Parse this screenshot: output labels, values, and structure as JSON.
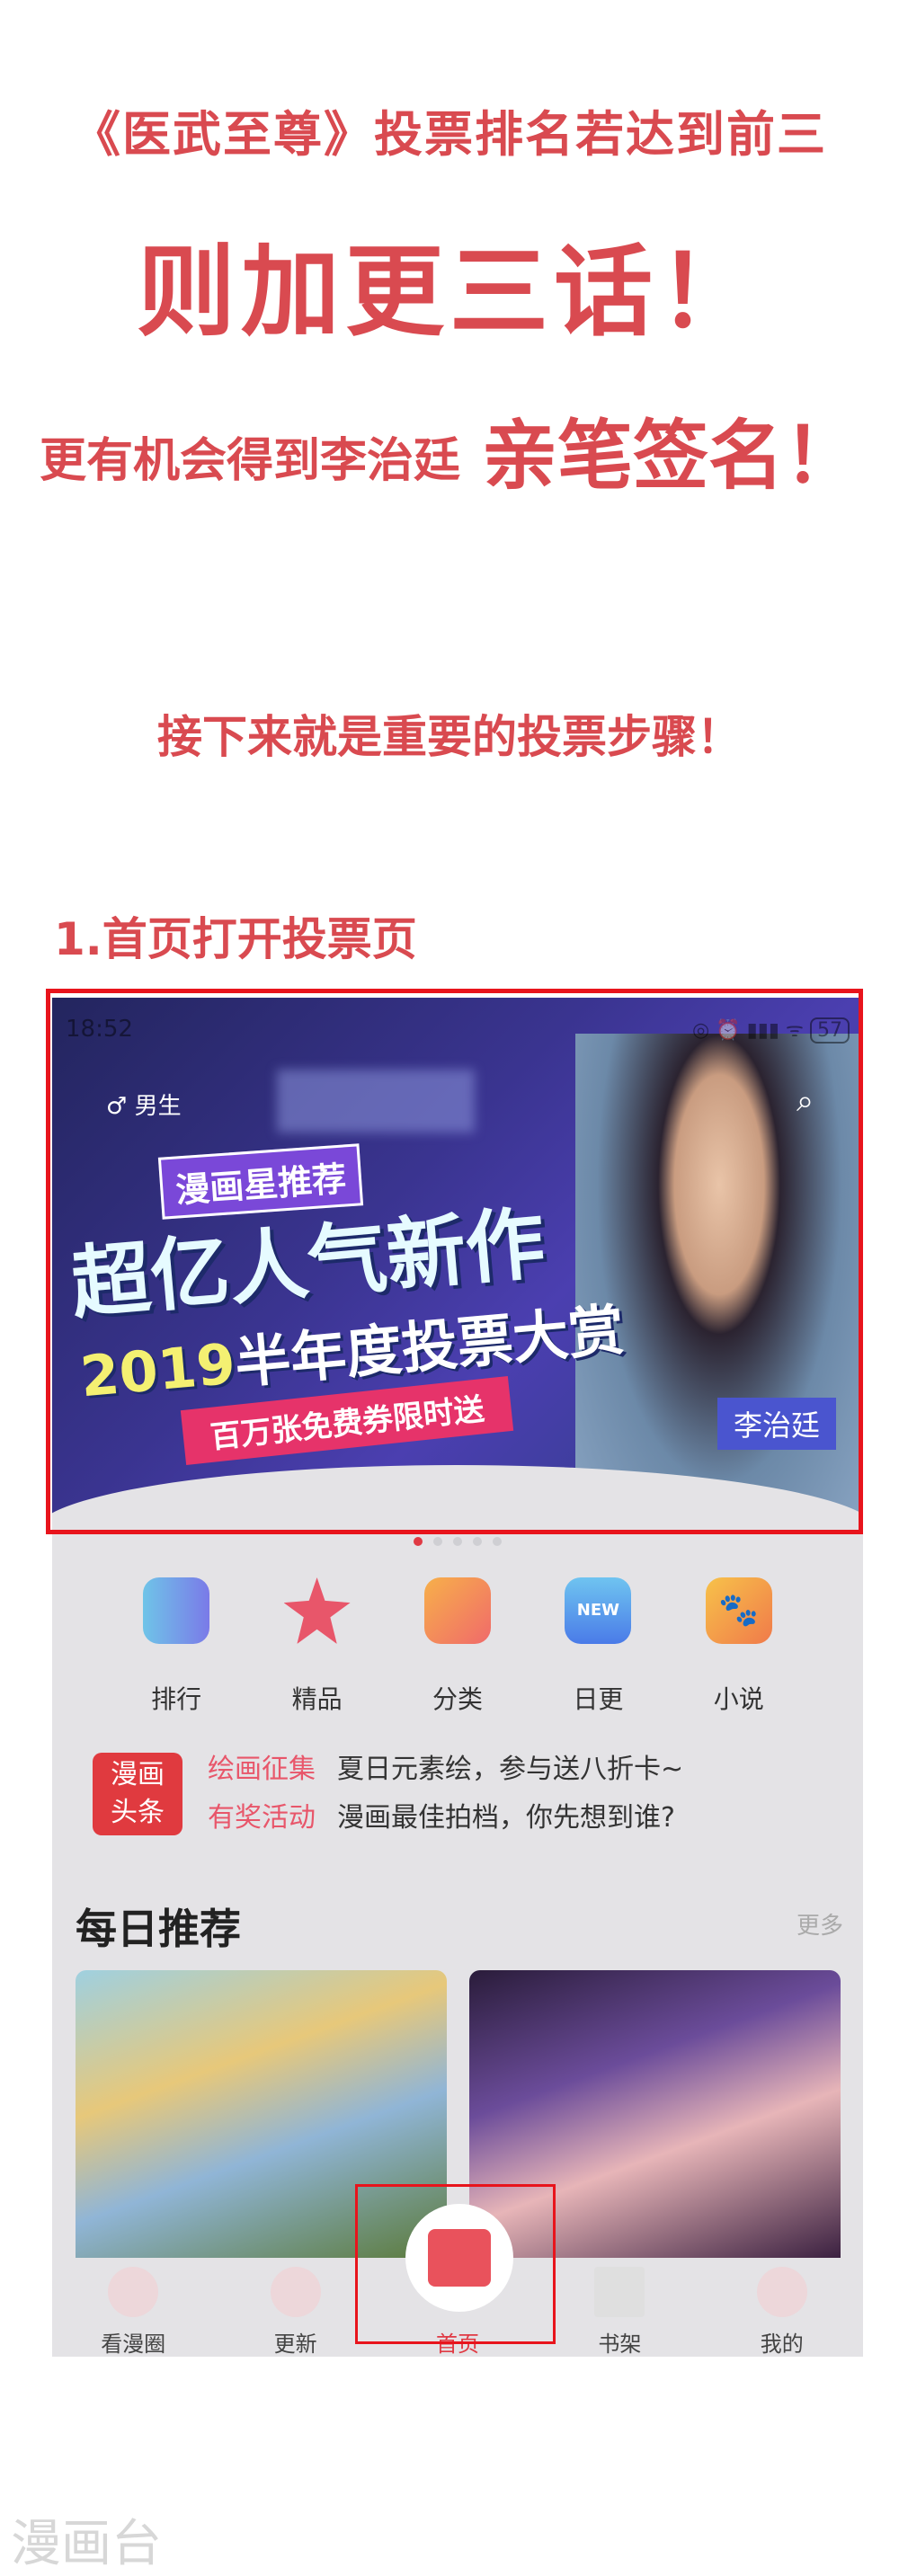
{
  "headline": {
    "line1": "《医武至尊》投票排名若达到前三",
    "line2": "则加更三话！",
    "line3_a": "更有机会得到李治廷",
    "line3_b": "亲笔签名！",
    "line4": "接下来就是重要的投票步骤！",
    "step1": "1.首页打开投票页"
  },
  "phone": {
    "status_time": "18:52",
    "battery": "57",
    "gender_label": "男生",
    "gender_icon": "male-icon",
    "search_icon": "search-icon",
    "banner": {
      "tag": "漫画星推荐",
      "title": "超亿人气新作",
      "subtitle_year": "2019",
      "subtitle": "半年度投票大赏",
      "ribbon": "百万张免费券限时送",
      "person_name": "李治廷",
      "active_dot": 1,
      "dot_count": 6
    },
    "quick_icons": [
      {
        "label": "排行",
        "icon": "ranking-icon",
        "color": "#6fa8e8"
      },
      {
        "label": "精品",
        "icon": "star-icon",
        "color": "#e8566a"
      },
      {
        "label": "分类",
        "icon": "category-icon",
        "color": "#f08a5a"
      },
      {
        "label": "日更",
        "icon": "new-icon",
        "color": "#4a8be8"
      },
      {
        "label": "小说",
        "icon": "paw-icon",
        "color": "#f0a83a"
      }
    ],
    "news": {
      "badge_line1": "漫画",
      "badge_line2": "头条",
      "items": [
        {
          "tag": "绘画征集",
          "text": "夏日元素绘，参与送八折卡~"
        },
        {
          "tag": "有奖活动",
          "text": "漫画最佳拍档，你先想到谁?"
        }
      ]
    },
    "section_title": "每日推荐",
    "more_label": "更多",
    "tabs": [
      {
        "label": "看漫圈",
        "icon": "donut-icon"
      },
      {
        "label": "更新",
        "icon": "paw-icon"
      },
      {
        "label": "首页",
        "icon": "home-icon",
        "active": true
      },
      {
        "label": "书架",
        "icon": "bookshelf-icon"
      },
      {
        "label": "我的",
        "icon": "cat-profile-icon"
      }
    ],
    "accent": "#e03a44"
  },
  "watermark": "漫画台",
  "colors": {
    "headline": "#d94a50",
    "highlight_frame": "#e8141c"
  }
}
